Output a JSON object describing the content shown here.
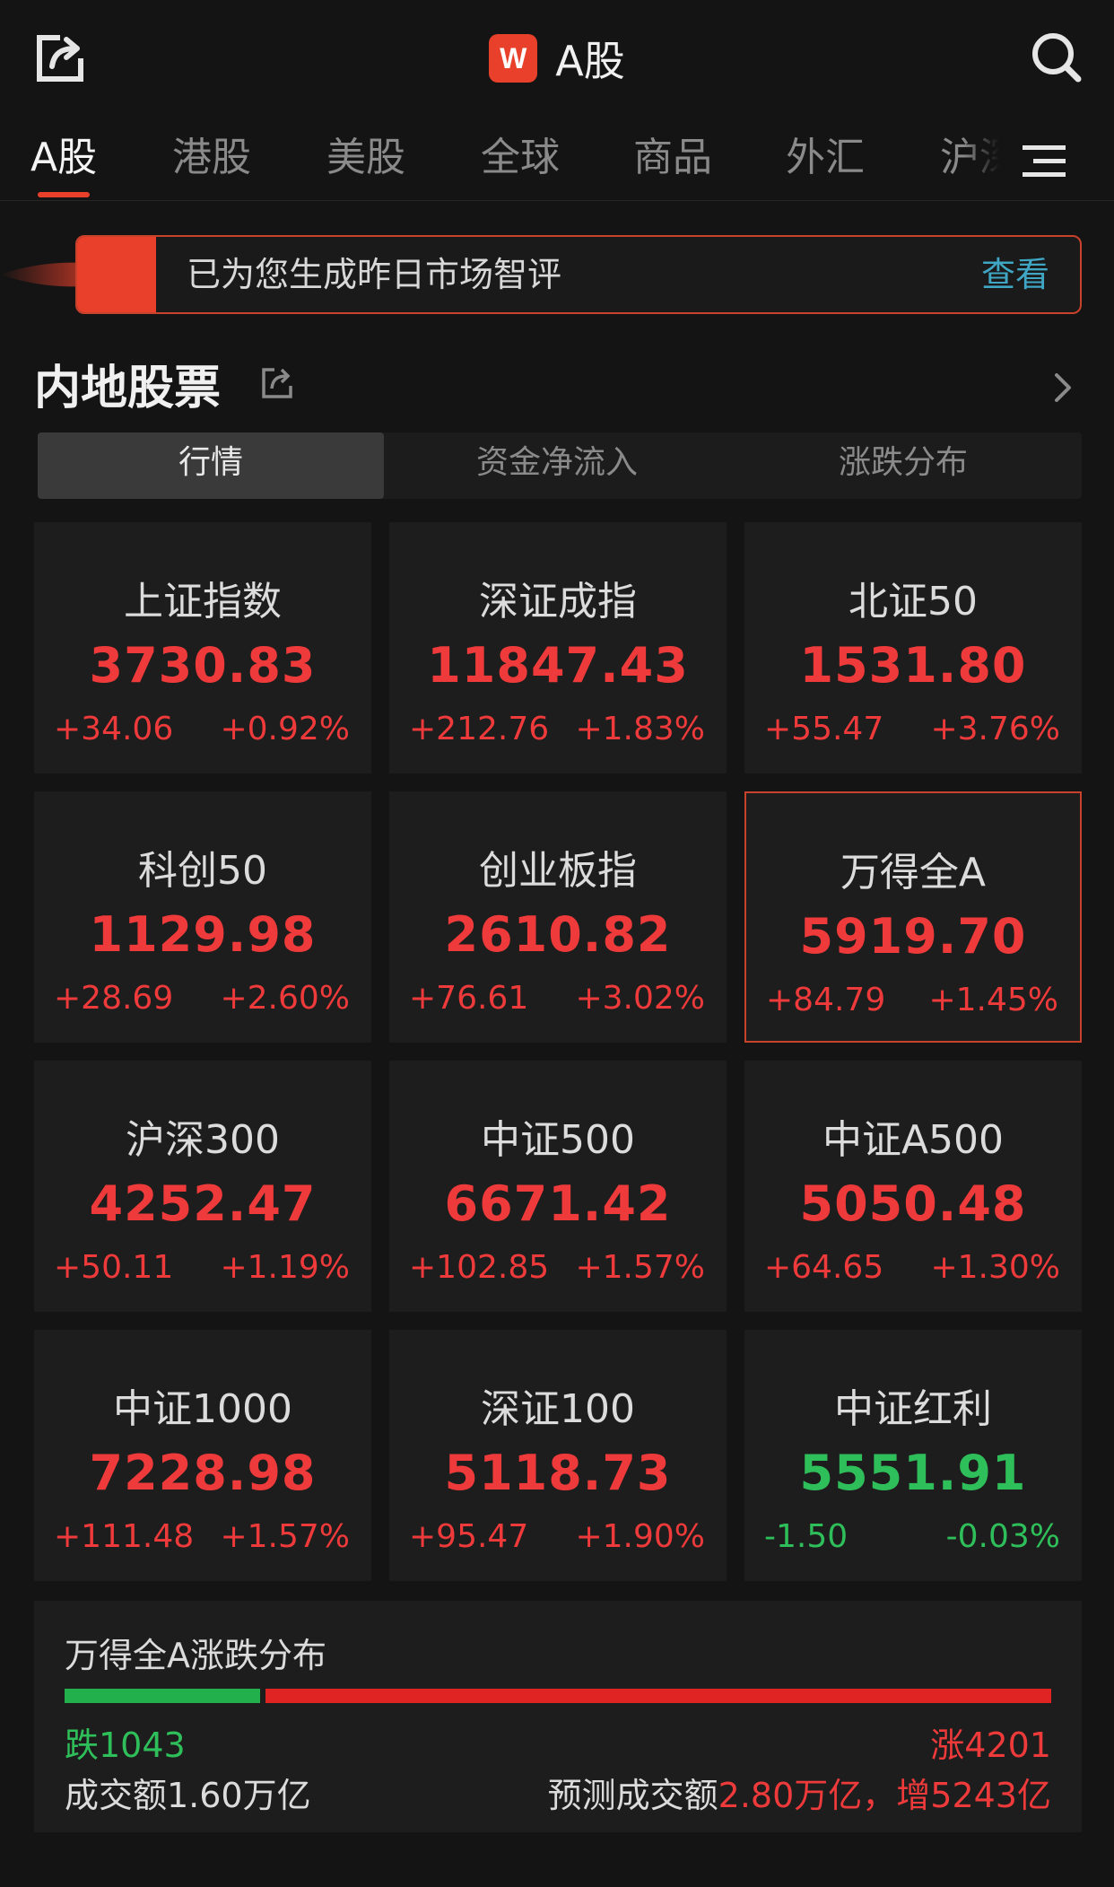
{
  "header": {
    "title": "A股",
    "logo_letter": "W",
    "logo_color": "#e8402b",
    "share_icon": "share-icon",
    "search_icon": "search-icon"
  },
  "tabs": [
    {
      "label": "A股",
      "active": true
    },
    {
      "label": "港股",
      "active": false
    },
    {
      "label": "美股",
      "active": false
    },
    {
      "label": "全球",
      "active": false
    },
    {
      "label": "商品",
      "active": false
    },
    {
      "label": "外汇",
      "active": false
    },
    {
      "label": "沪深",
      "active": false
    }
  ],
  "banner": {
    "text": "已为您生成昨日市场智评",
    "link": "查看"
  },
  "section": {
    "title": "内地股票"
  },
  "segments": [
    {
      "label": "行情",
      "active": true
    },
    {
      "label": "资金净流入",
      "active": false
    },
    {
      "label": "涨跌分布",
      "active": false
    }
  ],
  "indices": [
    {
      "name": "上证指数",
      "value": "3730.83",
      "change": "+34.06",
      "pct": "+0.92%",
      "direction": "up"
    },
    {
      "name": "深证成指",
      "value": "11847.43",
      "change": "+212.76",
      "pct": "+1.83%",
      "direction": "up"
    },
    {
      "name": "北证50",
      "value": "1531.80",
      "change": "+55.47",
      "pct": "+3.76%",
      "direction": "up"
    },
    {
      "name": "科创50",
      "value": "1129.98",
      "change": "+28.69",
      "pct": "+2.60%",
      "direction": "up"
    },
    {
      "name": "创业板指",
      "value": "2610.82",
      "change": "+76.61",
      "pct": "+3.02%",
      "direction": "up"
    },
    {
      "name": "万得全A",
      "value": "5919.70",
      "change": "+84.79",
      "pct": "+1.45%",
      "direction": "up",
      "selected": true
    },
    {
      "name": "沪深300",
      "value": "4252.47",
      "change": "+50.11",
      "pct": "+1.19%",
      "direction": "up"
    },
    {
      "name": "中证500",
      "value": "6671.42",
      "change": "+102.85",
      "pct": "+1.57%",
      "direction": "up"
    },
    {
      "name": "中证A500",
      "value": "5050.48",
      "change": "+64.65",
      "pct": "+1.30%",
      "direction": "up"
    },
    {
      "name": "中证1000",
      "value": "7228.98",
      "change": "+111.48",
      "pct": "+1.57%",
      "direction": "up"
    },
    {
      "name": "深证100",
      "value": "5118.73",
      "change": "+95.47",
      "pct": "+1.90%",
      "direction": "up"
    },
    {
      "name": "中证红利",
      "value": "5551.91",
      "change": "-1.50",
      "pct": "-0.03%",
      "direction": "down"
    }
  ],
  "breadth": {
    "title": "万得全A涨跌分布",
    "fall_label": "跌1043",
    "rise_label": "涨4201",
    "fall_count": 1043,
    "rise_count": 4201,
    "turnover": "成交额1.60万亿",
    "forecast_prefix": "预测成交额",
    "forecast_value": "2.80万亿，增5243亿"
  },
  "colors": {
    "up": "#ee3a3a",
    "down": "#2fbf5a",
    "accent": "#e8402b",
    "link": "#3fa6c4"
  }
}
